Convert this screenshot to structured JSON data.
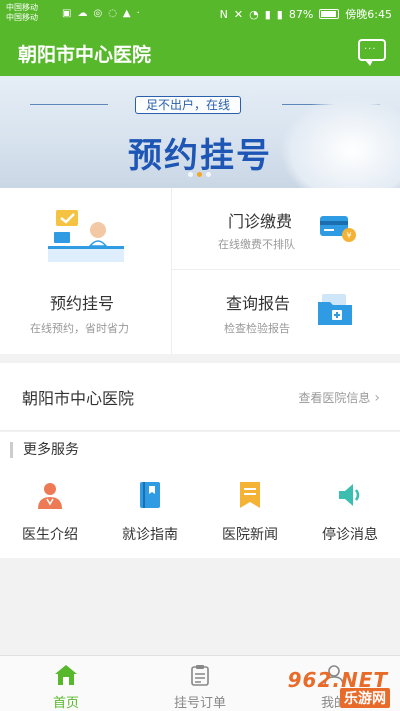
{
  "status_bar": {
    "carrier_1": "中国移动",
    "carrier_2": "中国移动",
    "battery_percent": "87%",
    "time": "傍晚6:45"
  },
  "app_bar": {
    "title": "朝阳市中心医院"
  },
  "banner": {
    "tagline": "足不出户，在线",
    "title": "预约挂号",
    "slide_count": 3,
    "active_slide": 2
  },
  "quick_grid": {
    "appointment": {
      "title": "预约挂号",
      "subtitle": "在线预约，省时省力"
    },
    "payment": {
      "title": "门诊缴费",
      "subtitle": "在线缴费不排队"
    },
    "report": {
      "title": "查询报告",
      "subtitle": "检查检验报告"
    }
  },
  "hospital": {
    "name": "朝阳市中心医院",
    "info_link": "查看医院信息"
  },
  "more_services": {
    "header": "更多服务",
    "items": [
      {
        "label": "医生介绍",
        "icon": "doctor-icon",
        "color": "#ee7a55"
      },
      {
        "label": "就诊指南",
        "icon": "guide-book-icon",
        "color": "#2e9be3"
      },
      {
        "label": "医院新闻",
        "icon": "news-bookmark-icon",
        "color": "#f5b335"
      },
      {
        "label": "停诊消息",
        "icon": "speaker-icon",
        "color": "#3bbdb0"
      }
    ]
  },
  "tab_bar": {
    "tabs": [
      {
        "label": "首页",
        "icon": "home-icon",
        "active": true
      },
      {
        "label": "挂号订单",
        "icon": "clipboard-icon",
        "active": false
      },
      {
        "label": "我的",
        "icon": "user-icon",
        "active": false
      }
    ]
  },
  "watermark": {
    "top": "962.NET",
    "bottom": "乐游网"
  },
  "colors": {
    "brand_green": "#58b82c",
    "banner_blue": "#1e56b5",
    "watermark_orange": "#e86b2a"
  }
}
